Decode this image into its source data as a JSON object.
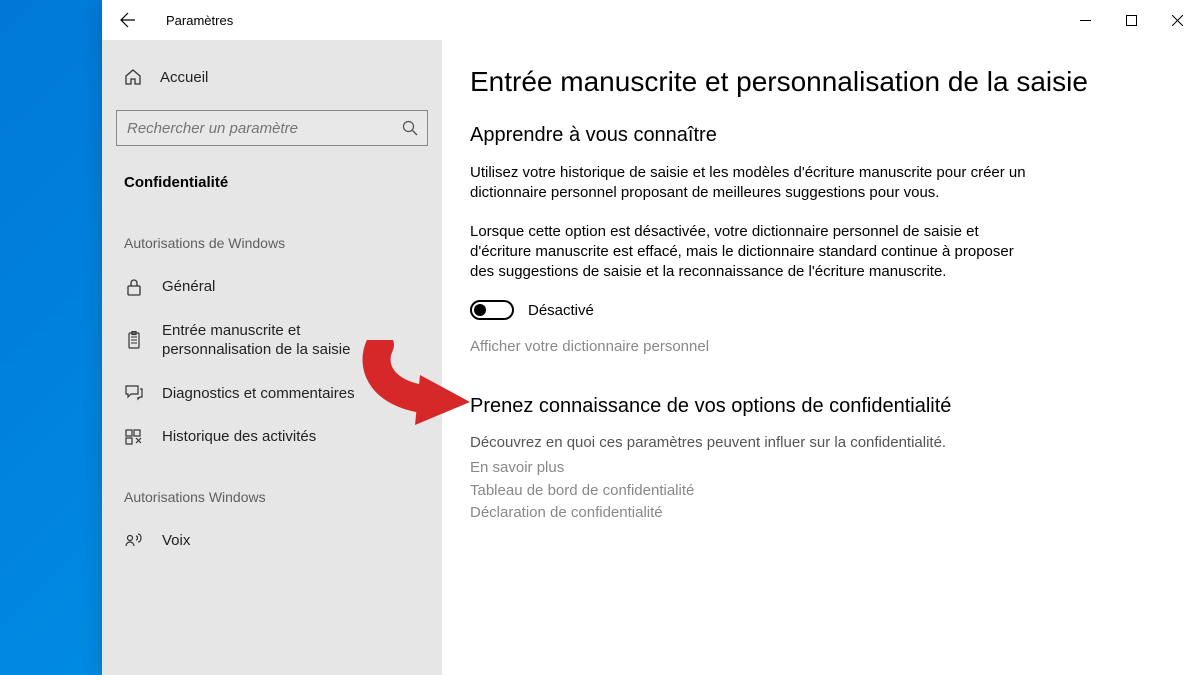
{
  "titlebar": {
    "title": "Paramètres"
  },
  "sidebar": {
    "home": "Accueil",
    "search_placeholder": "Rechercher un paramètre",
    "section": "Confidentialité",
    "group1": "Autorisations de Windows",
    "items1": [
      {
        "label": "Général"
      },
      {
        "label": "Entrée manuscrite et personnalisation de la saisie"
      },
      {
        "label": "Diagnostics et commentaires"
      },
      {
        "label": "Historique des activités"
      }
    ],
    "group2": "Autorisations Windows",
    "items2": [
      {
        "label": "Voix"
      }
    ]
  },
  "content": {
    "page_title": "Entrée manuscrite et personnalisation de la saisie",
    "heading1": "Apprendre à vous connaître",
    "para1": "Utilisez votre historique de saisie et les modèles d'écriture manuscrite pour créer un dictionnaire personnel proposant de meilleures suggestions pour vous.",
    "para2": "Lorsque cette option est désactivée, votre dictionnaire personnel de saisie et d'écriture manuscrite est effacé, mais le dictionnaire standard continue à proposer des suggestions de saisie et la reconnaissance de l'écriture manuscrite.",
    "toggle_label": "Désactivé",
    "link_personal_dict": "Afficher votre dictionnaire personnel",
    "heading2": "Prenez connaissance de vos options de confidentialité",
    "sub_desc": "Découvrez en quoi ces paramètres peuvent influer sur la confidentialité.",
    "link_learn": "En savoir plus",
    "link_dashboard": "Tableau de bord de confidentialité",
    "link_declaration": "Déclaration de confidentialité"
  }
}
